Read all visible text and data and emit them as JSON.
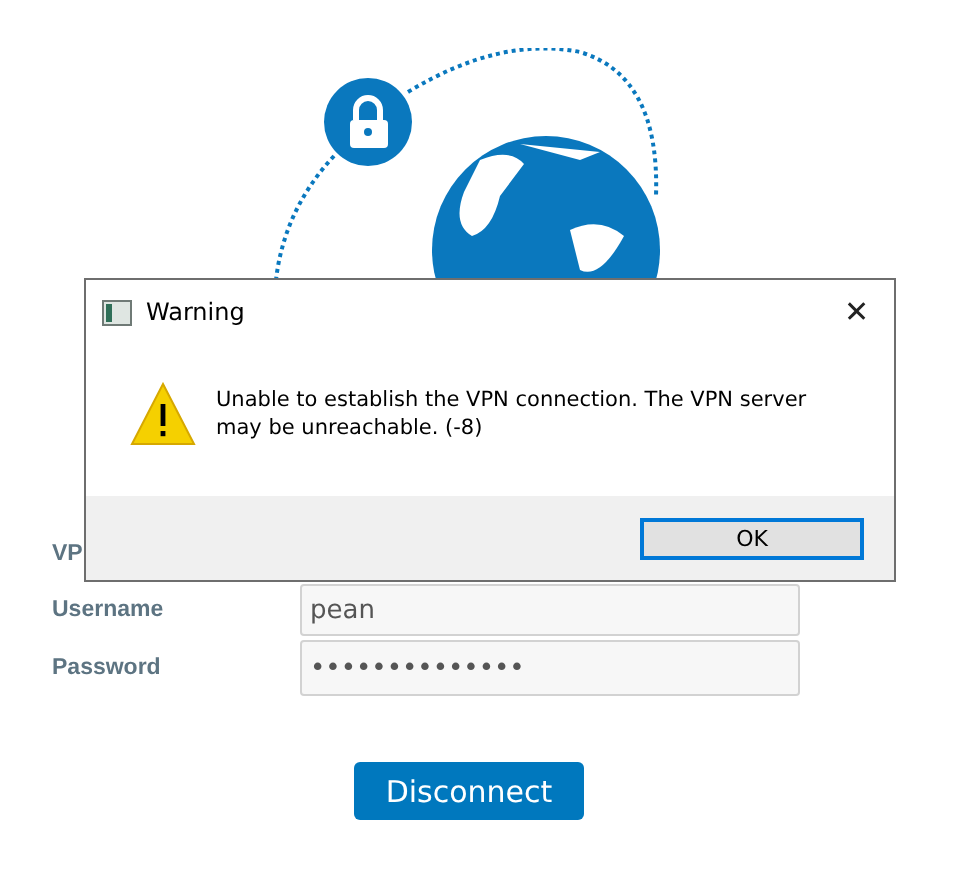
{
  "vpn_form": {
    "fields": [
      {
        "label": "VP"
      },
      {
        "label": "Username",
        "value": "pean"
      },
      {
        "label": "Password",
        "value": "••••••••••••••"
      }
    ],
    "connect_button": "Disconnect"
  },
  "dialog": {
    "title": "Warning",
    "close": "✕",
    "message": "Unable to establish the VPN connection. The VPN server may be unreachable. (-8)",
    "buttons": [
      "OK"
    ]
  }
}
